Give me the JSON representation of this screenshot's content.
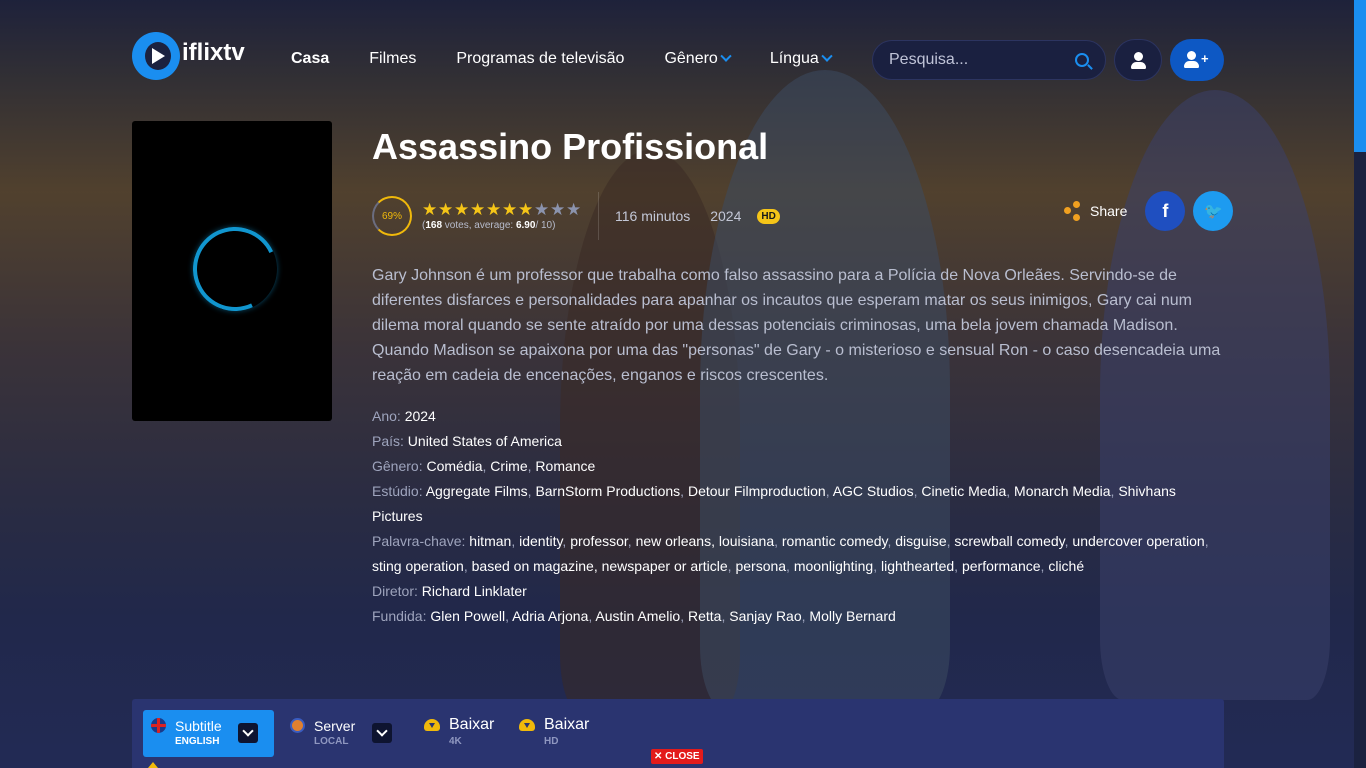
{
  "header": {
    "logo_text": "iflixtv",
    "nav": [
      {
        "label": "Casa",
        "active": true,
        "dropdown": false
      },
      {
        "label": "Filmes",
        "active": false,
        "dropdown": false
      },
      {
        "label": "Programas de televisão",
        "active": false,
        "dropdown": false
      },
      {
        "label": "Gênero",
        "active": false,
        "dropdown": true
      },
      {
        "label": "Língua",
        "active": false,
        "dropdown": true
      }
    ],
    "search_placeholder": "Pesquisa..."
  },
  "movie": {
    "title": "Assassino Profissional",
    "rating_percent": "69%",
    "stars_filled": 7,
    "stars_total": 10,
    "votes_count": "168",
    "votes_text_mid": " votes, average: ",
    "average": "6.90",
    "average_suffix": "/ 10)",
    "votes_prefix": "(",
    "runtime": "116 minutos",
    "year": "2024",
    "quality_badge": "HD",
    "overview": "Gary Johnson é um professor que trabalha como falso assassino para a Polícia de Nova Orleães. Servindo-se de diferentes disfarces e personalidades para apanhar os incautos que esperam matar os seus inimigos, Gary cai num dilema moral quando se sente atraído por uma dessas potenciais criminosas, uma bela jovem chamada Madison. Quando Madison se apaixona por uma das \"personas\" de Gary - o misterioso e sensual Ron - o caso desencadeia uma reação em cadeia de encenações, enganos e riscos crescentes.",
    "facts": [
      {
        "label": "Ano:",
        "values": [
          "2024"
        ]
      },
      {
        "label": "País:",
        "values": [
          "United States of America"
        ]
      },
      {
        "label": "Gênero:",
        "values": [
          "Comédia",
          "Crime",
          "Romance"
        ]
      },
      {
        "label": "Estúdio:",
        "values": [
          "Aggregate Films",
          "BarnStorm Productions",
          "Detour Filmproduction",
          "AGC Studios",
          "Cinetic Media",
          "Monarch Media",
          "Shivhans Pictures"
        ]
      },
      {
        "label": "Palavra-chave:",
        "values": [
          "hitman",
          "identity",
          "professor",
          "new orleans, louisiana",
          "romantic comedy",
          "disguise",
          "screwball comedy",
          "undercover operation",
          "sting operation",
          "based on magazine, newspaper or article",
          "persona",
          "moonlighting",
          "lighthearted",
          "performance",
          "cliché"
        ]
      },
      {
        "label": "Diretor:",
        "values": [
          "Richard Linklater"
        ]
      },
      {
        "label": "Fundida:",
        "values": [
          "Glen Powell",
          "Adria Arjona",
          "Austin Amelio",
          "Retta",
          "Sanjay Rao",
          "Molly Bernard"
        ]
      }
    ]
  },
  "share": {
    "label": "Share",
    "facebook_glyph": "f",
    "twitter_glyph": "🐦"
  },
  "player": {
    "subtitle_label": "Subtitle",
    "subtitle_value": "ENGLISH",
    "server_label": "Server",
    "server_value": "LOCAL",
    "download_4k_label": "Baixar",
    "download_4k_quality": "4K",
    "download_hd_label": "Baixar",
    "download_hd_quality": "HD",
    "close_label": "✕ CLOSE"
  },
  "colors": {
    "accent": "#1a8ef0",
    "star": "#f5c518",
    "background": "#212847"
  }
}
